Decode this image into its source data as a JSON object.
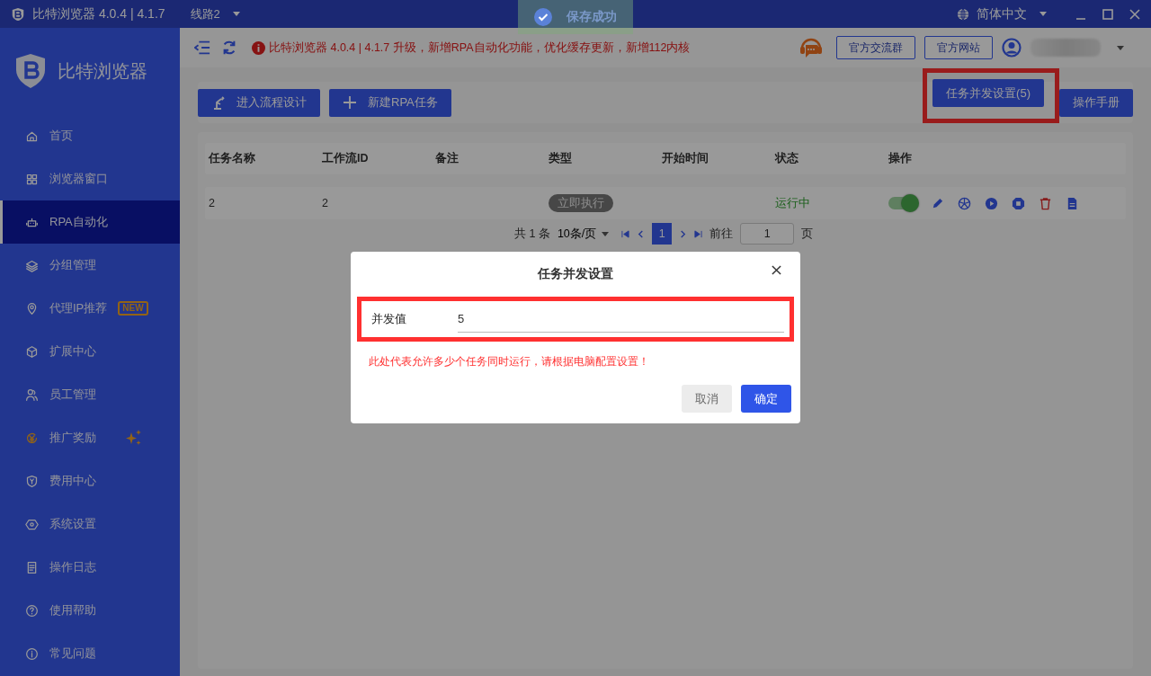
{
  "title_bar": {
    "app_title": "比特浏览器 4.0.4 | 4.1.7",
    "route": "线路2",
    "language": "简体中文"
  },
  "toast": {
    "message": "保存成功"
  },
  "sidebar": {
    "brand": "比特浏览器",
    "items": [
      {
        "label": "首页",
        "selected": false,
        "kind": "normal"
      },
      {
        "label": "浏览器窗口",
        "selected": false,
        "kind": "normal"
      },
      {
        "label": "RPA自动化",
        "selected": true,
        "kind": "normal"
      },
      {
        "label": "分组管理",
        "selected": false,
        "kind": "normal"
      },
      {
        "label": "代理IP推荐",
        "selected": false,
        "kind": "normal",
        "badge": "NEW"
      },
      {
        "label": "扩展中心",
        "selected": false,
        "kind": "normal"
      },
      {
        "label": "员工管理",
        "selected": false,
        "kind": "normal"
      },
      {
        "label": "推广奖励",
        "selected": false,
        "kind": "promo"
      },
      {
        "label": "费用中心",
        "selected": false,
        "kind": "normal"
      },
      {
        "label": "系统设置",
        "selected": false,
        "kind": "normal"
      },
      {
        "label": "操作日志",
        "selected": false,
        "kind": "normal"
      },
      {
        "label": "使用帮助",
        "selected": false,
        "kind": "normal"
      },
      {
        "label": "常见问题",
        "selected": false,
        "kind": "normal"
      }
    ]
  },
  "header": {
    "notice": "比特浏览器 4.0.4 | 4.1.7 升级，新增RPA自动化功能，优化缓存更新，新增112内核",
    "links": [
      "官方交流群",
      "官方网站"
    ]
  },
  "toolbar": {
    "left_buttons": [
      "进入流程设计",
      "新建RPA任务"
    ],
    "right_buttons": [
      {
        "label": "任务并发设置(5)",
        "highlighted": true
      },
      {
        "label": "操作手册",
        "highlighted": false
      }
    ]
  },
  "table": {
    "columns": [
      "任务名称",
      "工作流ID",
      "备注",
      "类型",
      "开始时间",
      "状态",
      "操作"
    ],
    "rows": [
      {
        "name": "2",
        "workflow_id": "2",
        "type": "立即执行",
        "status": "运行中",
        "enabled": true
      }
    ]
  },
  "pagination": {
    "total": "共 1 条",
    "page_size": "10条/页",
    "pages": [
      {
        "label": "1",
        "selected": true
      }
    ],
    "goto_label": "前往",
    "goto_value": "1",
    "page_suffix": "页"
  },
  "dialog": {
    "title": "任务并发设置",
    "field_label": "并发值",
    "field_value": "5",
    "field_highlighted": true,
    "hint": "此处代表允许多少个任务同时运行，请根据电脑配置设置！",
    "buttons": [
      {
        "label": "取消",
        "kind": "secondary"
      },
      {
        "label": "确定",
        "kind": "primary"
      }
    ]
  }
}
